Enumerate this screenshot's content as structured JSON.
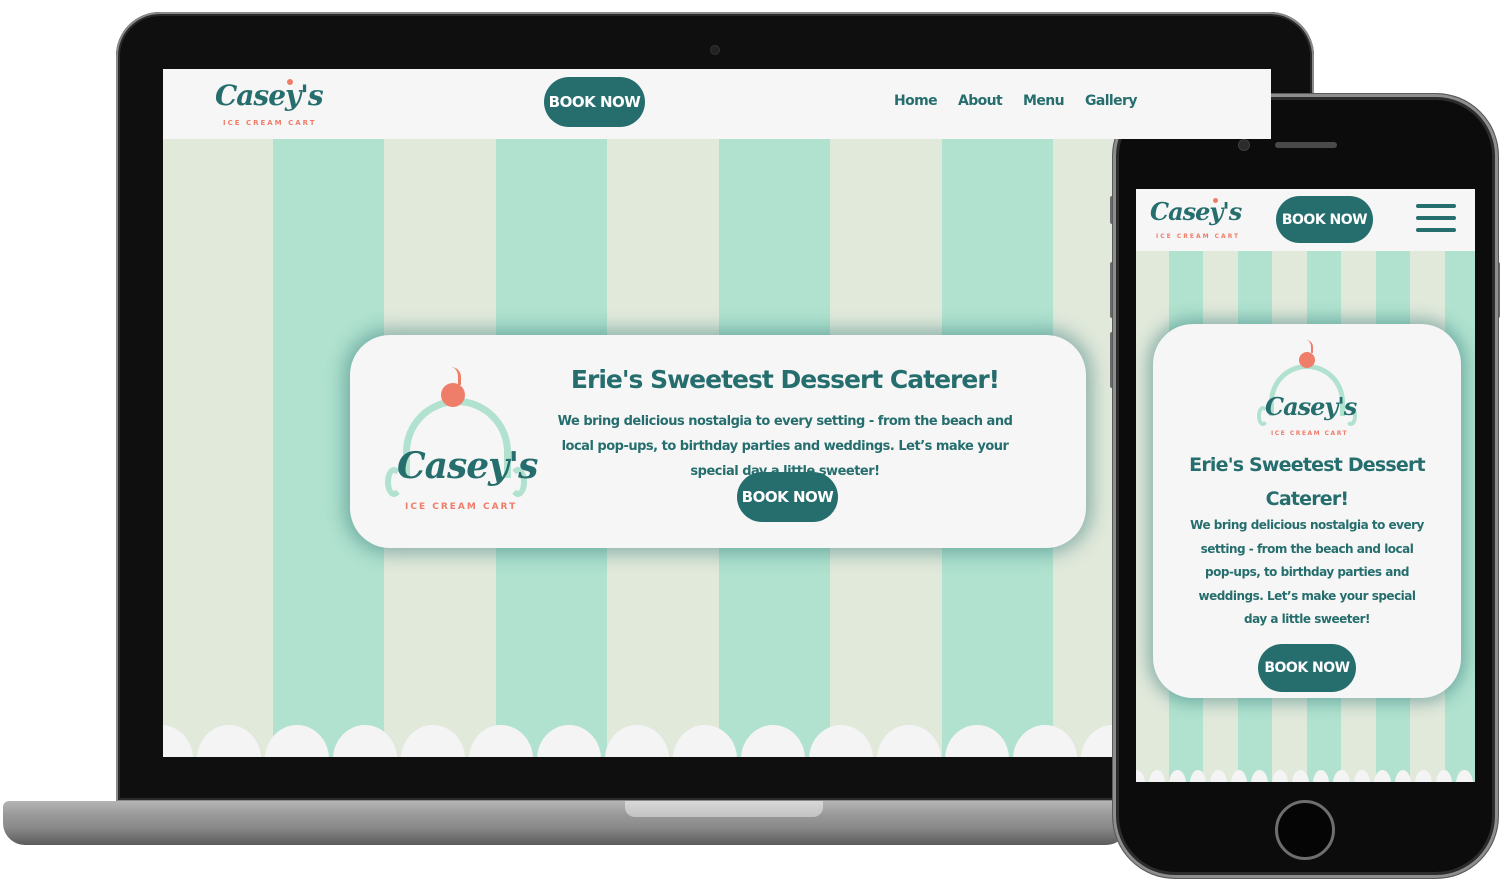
{
  "brand": {
    "name": "Casey's",
    "tagline": "ICE CREAM CART",
    "colors": {
      "primary_teal": "#266e6e",
      "accent_salmon": "#ee7e6a",
      "stripe_mint": "#b0e2cf",
      "stripe_sage": "#e1e9db",
      "card_bg": "#f6f6f6"
    }
  },
  "desktop": {
    "header": {
      "book_label": "BOOK NOW",
      "nav": [
        {
          "label": "Home"
        },
        {
          "label": "About"
        },
        {
          "label": "Menu"
        },
        {
          "label": "Gallery"
        }
      ]
    },
    "hero": {
      "title": "Erie's Sweetest Dessert Caterer!",
      "body": "We bring delicious nostalgia to every setting - from the beach and local pop-ups, to birthday parties and weddings. Let’s make your special day a little sweeter!",
      "book_label": "BOOK NOW"
    }
  },
  "mobile": {
    "header": {
      "book_label": "BOOK NOW",
      "menu_icon": "hamburger-icon"
    },
    "hero": {
      "title": "Erie's Sweetest Dessert Caterer!",
      "body": "We bring delicious nostalgia to every setting - from the beach and local pop-ups, to birthday parties and weddings. Let’s make your special day a little sweeter!",
      "book_label": "BOOK NOW"
    }
  }
}
